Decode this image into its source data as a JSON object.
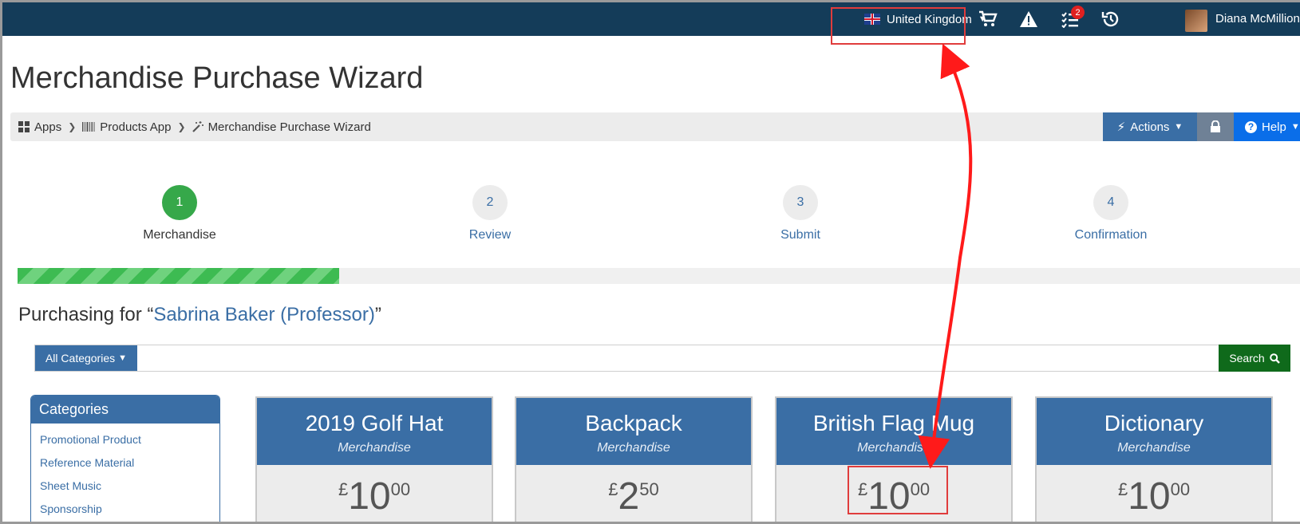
{
  "header": {
    "country": "United Kingdom",
    "notification_count": "2",
    "user_name": "Diana McMillion"
  },
  "page_title": "Merchandise Purchase Wizard",
  "breadcrumb": {
    "items": [
      "Apps",
      "Products App",
      "Merchandise Purchase Wizard"
    ]
  },
  "toolbar": {
    "actions_label": "Actions",
    "help_label": "Help"
  },
  "steps": [
    {
      "number": "1",
      "label": "Merchandise",
      "active": true
    },
    {
      "number": "2",
      "label": "Review",
      "active": false
    },
    {
      "number": "3",
      "label": "Submit",
      "active": false
    },
    {
      "number": "4",
      "label": "Confirmation",
      "active": false
    }
  ],
  "progress": {
    "percent": 25
  },
  "purchasing": {
    "prefix": "Purchasing for “",
    "person": "Sabrina Baker (Professor)",
    "suffix": "”"
  },
  "search": {
    "category_label": "All Categories",
    "query": "",
    "button_label": "Search"
  },
  "categories": {
    "title": "Categories",
    "items": [
      "Promotional Product",
      "Reference Material",
      "Sheet Music",
      "Sponsorship"
    ]
  },
  "products": [
    {
      "name": "2019 Golf Hat",
      "type": "Merchandise",
      "currency": "£",
      "whole": "10",
      "fraction": "00"
    },
    {
      "name": "Backpack",
      "type": "Merchandise",
      "currency": "£",
      "whole": "2",
      "fraction": "50"
    },
    {
      "name": "British Flag Mug",
      "type": "Merchandise",
      "currency": "£",
      "whole": "10",
      "fraction": "00"
    },
    {
      "name": "Dictionary",
      "type": "Merchandise",
      "currency": "£",
      "whole": "10",
      "fraction": "00"
    }
  ],
  "colors": {
    "topbar": "#143c59",
    "primary": "#3a6ea5",
    "success": "#36a84a",
    "search_button": "#0f6a1b",
    "help_button": "#0a6ee9",
    "annotation": "#e03c3c"
  }
}
